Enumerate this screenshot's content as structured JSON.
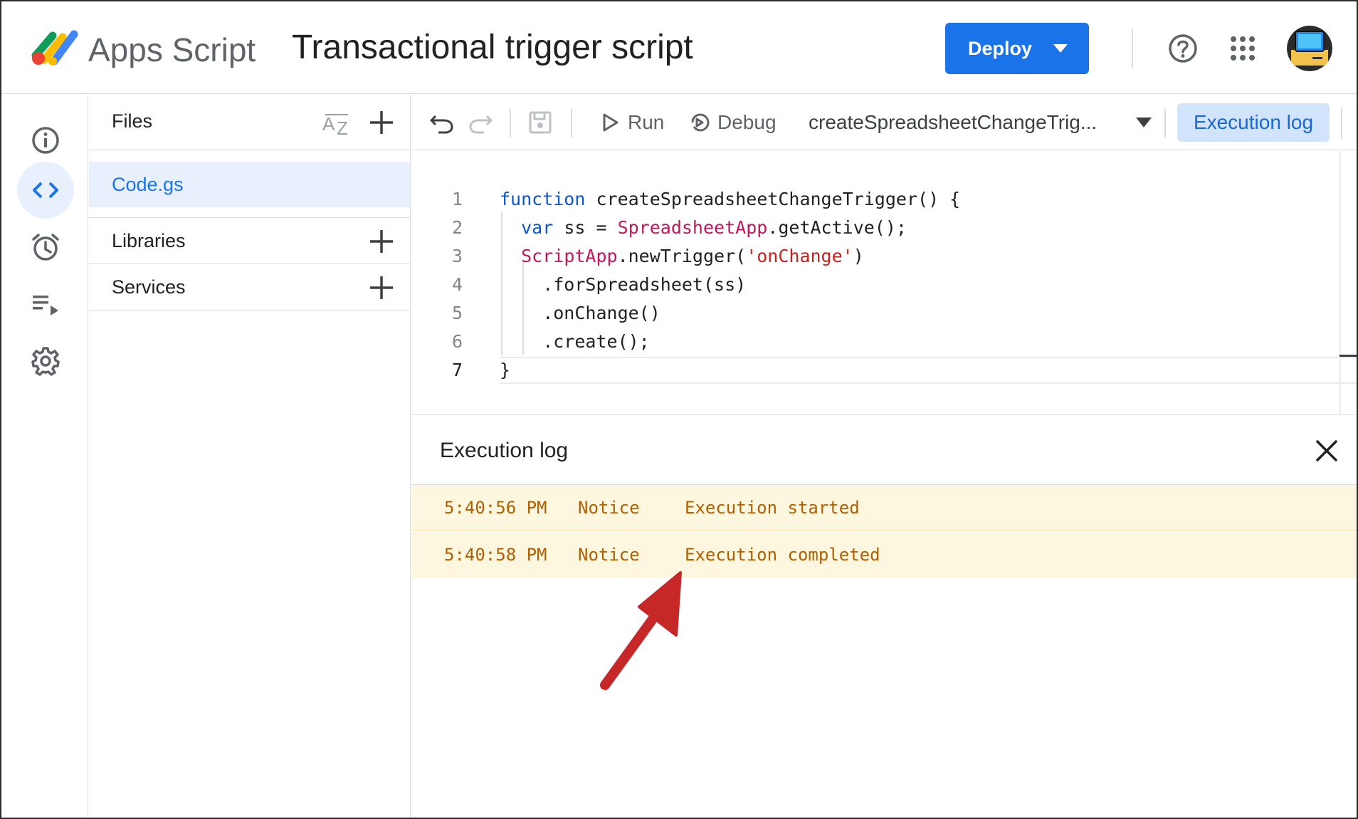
{
  "header": {
    "product_name": "Apps Script",
    "project_title": "Transactional trigger script",
    "deploy_label": "Deploy",
    "help_icon": "help-circle-icon",
    "apps_icon": "apps-grid-icon",
    "avatar_icon": "user-avatar"
  },
  "rail": {
    "items": [
      {
        "icon": "info-icon",
        "label": "Overview"
      },
      {
        "icon": "code-icon",
        "label": "Editor",
        "active": true
      },
      {
        "icon": "alarm-clock-icon",
        "label": "Triggers"
      },
      {
        "icon": "executions-icon",
        "label": "Executions"
      },
      {
        "icon": "gear-icon",
        "label": "Project Settings"
      }
    ]
  },
  "files_panel": {
    "files_label": "Files",
    "file_name": "Code.gs",
    "libraries_label": "Libraries",
    "services_label": "Services"
  },
  "toolbar": {
    "run_label": "Run",
    "debug_label": "Debug",
    "function_selected": "createSpreadsheetChangeTrig...",
    "execution_log_label": "Execution log"
  },
  "editor": {
    "line_numbers": [
      "1",
      "2",
      "3",
      "4",
      "5",
      "6",
      "7"
    ],
    "lines": [
      {
        "kw": "function",
        "rest": " createSpreadsheetChangeTrigger() {"
      },
      {
        "indent": "  ",
        "kw": "var",
        "rest": " ss = ",
        "cls": "SpreadsheetApp",
        "tail": ".getActive();"
      },
      {
        "indent": "  ",
        "cls": "ScriptApp",
        "rest": ".newTrigger(",
        "str": "'onChange'",
        "tail": ")"
      },
      {
        "text": "    .forSpreadsheet(ss)"
      },
      {
        "text": "    .onChange()"
      },
      {
        "text": "    .create();"
      },
      {
        "text": "}"
      }
    ]
  },
  "execution_log": {
    "title": "Execution log",
    "rows": [
      {
        "time": "5:40:56 PM",
        "level": "Notice",
        "message": "Execution started"
      },
      {
        "time": "5:40:58 PM",
        "level": "Notice",
        "message": "Execution completed"
      }
    ]
  },
  "colors": {
    "accent": "#1a73e8",
    "log_bg": "#fef7e0",
    "log_text": "#b06000",
    "annotation_arrow": "#c62828"
  }
}
